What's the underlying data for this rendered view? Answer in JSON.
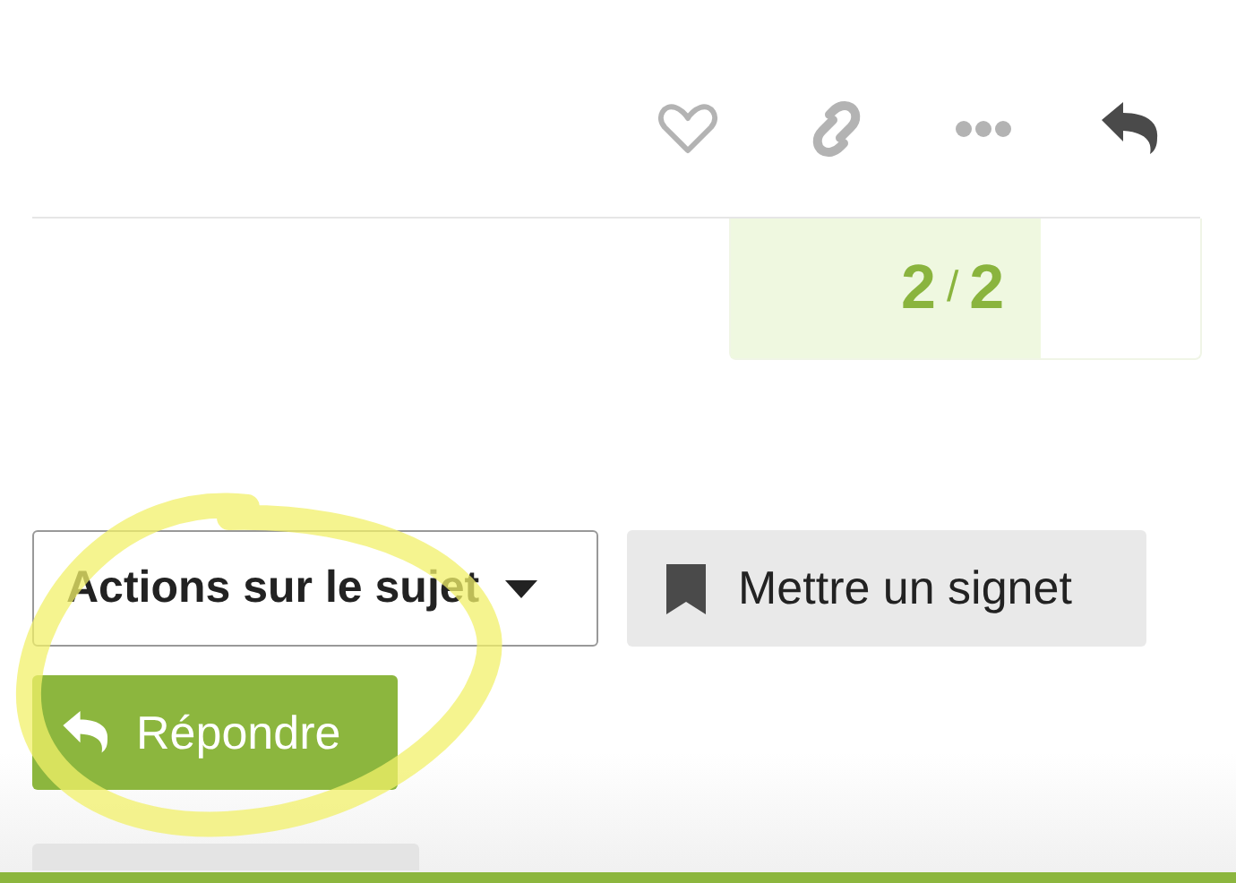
{
  "post_actions": [
    {
      "kind": "like"
    },
    {
      "kind": "link"
    },
    {
      "kind": "more"
    },
    {
      "kind": "reply"
    }
  ],
  "progress": {
    "current": "2",
    "separator": "/",
    "total": "2",
    "level": 0.66
  },
  "topic_buttons": {
    "actions": {
      "label": "Actions sur le sujet"
    },
    "bookmark": {
      "label": "Mettre un signet"
    },
    "reply": {
      "label": "Répondre"
    }
  },
  "annotation": {
    "kind": "circle"
  }
}
